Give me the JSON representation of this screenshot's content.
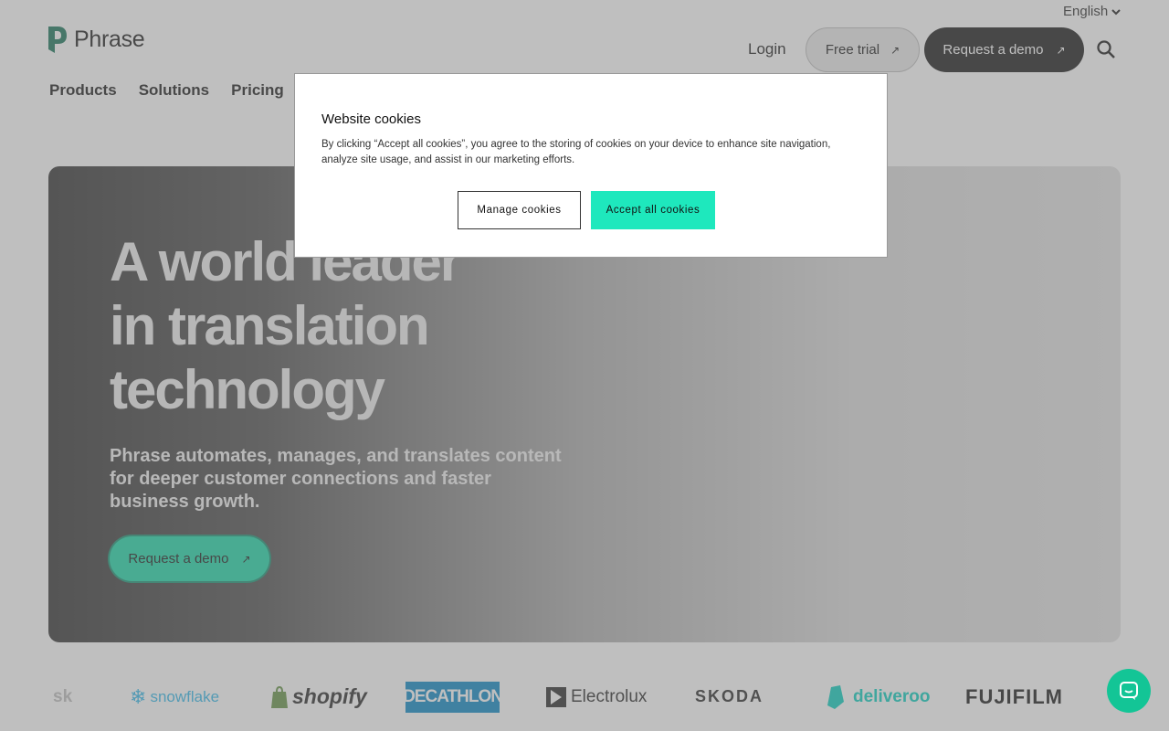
{
  "header": {
    "language": "English",
    "logo_text": "Phrase",
    "nav": [
      "Products",
      "Solutions",
      "Pricing"
    ],
    "login": "Login",
    "free_trial": "Free trial",
    "request_demo": "Request a demo"
  },
  "hero": {
    "title_lines": [
      "A world leader",
      "in translation",
      "technology"
    ],
    "subtitle_lines": [
      "Phrase automates, manages, and translates content",
      "for deeper customer connections and faster",
      "business growth."
    ],
    "cta": "Request a demo"
  },
  "logos": [
    "sk",
    "snowflake",
    "shopify",
    "DECATHLON",
    "Electrolux",
    "SKODA",
    "deliveroo",
    "FUJIFILM"
  ],
  "cookie_modal": {
    "title": "Website cookies",
    "text_lines": [
      "By clicking “Accept all cookies”, you agree to the storing of cookies on your device to enhance site navigation,",
      "analyze site usage, and assist in our marketing efforts."
    ],
    "manage_button": "Manage cookies",
    "accept_button": "Accept all cookies"
  },
  "colors": {
    "brand_green": "#13d7a4",
    "accept_green": "#1ee8bd",
    "dark_button": "#111111"
  },
  "icons": [
    "chevron-down-icon",
    "phrase-logo-icon",
    "arrow-up-right-icon",
    "search-icon",
    "chat-icon"
  ]
}
